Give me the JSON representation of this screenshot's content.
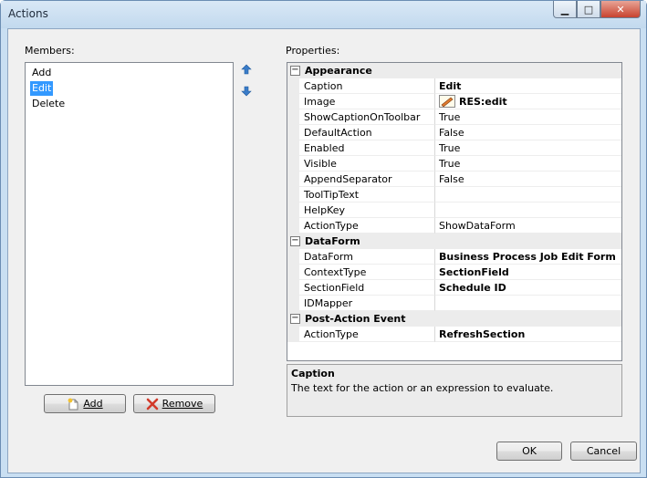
{
  "window": {
    "title": "Actions",
    "minimize_glyph": "▁",
    "maximize_glyph": "□",
    "close_glyph": "✕"
  },
  "members": {
    "label": "Members:",
    "items": [
      {
        "label": "Add",
        "selected": false
      },
      {
        "label": "Edit",
        "selected": true
      },
      {
        "label": "Delete",
        "selected": false
      }
    ],
    "move_up_icon": "arrow-up-icon",
    "move_down_icon": "arrow-down-icon",
    "add_button": {
      "label": "Add",
      "icon": "new-document-icon"
    },
    "remove_button": {
      "label": "Remove",
      "icon": "red-x-icon"
    }
  },
  "properties": {
    "label": "Properties:",
    "categories": [
      {
        "name": "Appearance",
        "rows": [
          {
            "name": "Caption",
            "value": "Edit",
            "bold": true
          },
          {
            "name": "Image",
            "value": "RES:edit",
            "bold": true,
            "icon": "pencil-icon"
          },
          {
            "name": "ShowCaptionOnToolbar",
            "value": "True",
            "bold": false
          },
          {
            "name": "DefaultAction",
            "value": "False",
            "bold": false
          },
          {
            "name": "Enabled",
            "value": "True",
            "bold": false
          },
          {
            "name": "Visible",
            "value": "True",
            "bold": false
          },
          {
            "name": "AppendSeparator",
            "value": "False",
            "bold": false
          },
          {
            "name": "ToolTipText",
            "value": "",
            "bold": false
          },
          {
            "name": "HelpKey",
            "value": "",
            "bold": false
          },
          {
            "name": "ActionType",
            "value": "ShowDataForm",
            "bold": false
          }
        ]
      },
      {
        "name": "DataForm",
        "rows": [
          {
            "name": "DataForm",
            "value": "Business Process Job Edit Form",
            "bold": true
          },
          {
            "name": "ContextType",
            "value": "SectionField",
            "bold": true
          },
          {
            "name": "SectionField",
            "value": "Schedule ID",
            "bold": true
          },
          {
            "name": "IDMapper",
            "value": "",
            "bold": false
          }
        ]
      },
      {
        "name": "Post-Action Event",
        "rows": [
          {
            "name": "ActionType",
            "value": "RefreshSection",
            "bold": true
          }
        ]
      }
    ],
    "collapse_glyph": "−",
    "help": {
      "title": "Caption",
      "text": "The text for the action or an expression to evaluate."
    }
  },
  "footer": {
    "ok_label": "OK",
    "cancel_label": "Cancel"
  },
  "colors": {
    "selection": "#3399ff",
    "dialog_background": "#f0f0f0",
    "category_background": "#ececec",
    "arrow_icon": "#3a7cc8",
    "remove_icon": "#d23a2a"
  }
}
